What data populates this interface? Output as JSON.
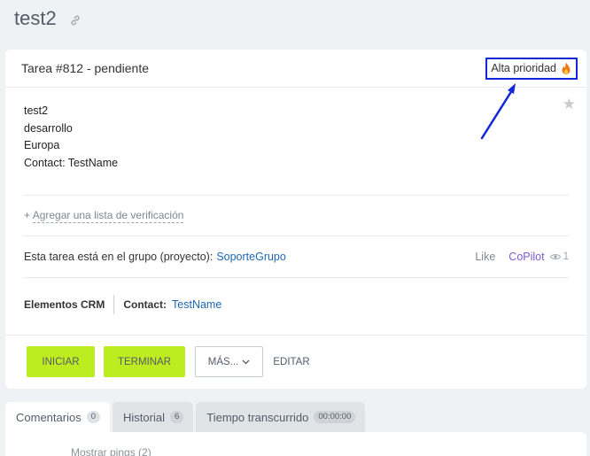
{
  "page": {
    "title": "test2"
  },
  "task": {
    "heading": "Tarea #812 - pendiente",
    "priority_label": "Alta prioridad",
    "description": [
      "test2",
      "desarrollo",
      "Europa",
      "Contact: TestName"
    ],
    "checklist_label": "Agregar una lista de verificación",
    "checklist_prefix": "+",
    "group_text": "Esta tarea está en el grupo (proyecto):",
    "group_link": "SoporteGrupo",
    "like_label": "Like",
    "copilot_label": "CoPilot",
    "views_count": "1",
    "crm_label": "Elementos CRM",
    "crm_contact_label": "Contact:",
    "crm_contact_name": "TestName"
  },
  "actions": {
    "start": "INICIAR",
    "finish": "TERMINAR",
    "more": "MÁS...",
    "edit": "EDITAR"
  },
  "tabs": [
    {
      "label": "Comentarios",
      "count": "0"
    },
    {
      "label": "Historial",
      "count": "6"
    },
    {
      "label": "Tiempo transcurrido",
      "count": "00:00:00"
    }
  ],
  "comments": {
    "show_pings": "Mostrar pings (2)"
  },
  "colors": {
    "accent_green": "#bbed21",
    "link_blue": "#2067b0",
    "annotation_blue": "#1427d6",
    "copilot_purple": "#7a5bd0"
  },
  "icons": [
    "link-icon",
    "flame-icon",
    "star-icon",
    "eye-icon",
    "chevron-down-icon"
  ]
}
